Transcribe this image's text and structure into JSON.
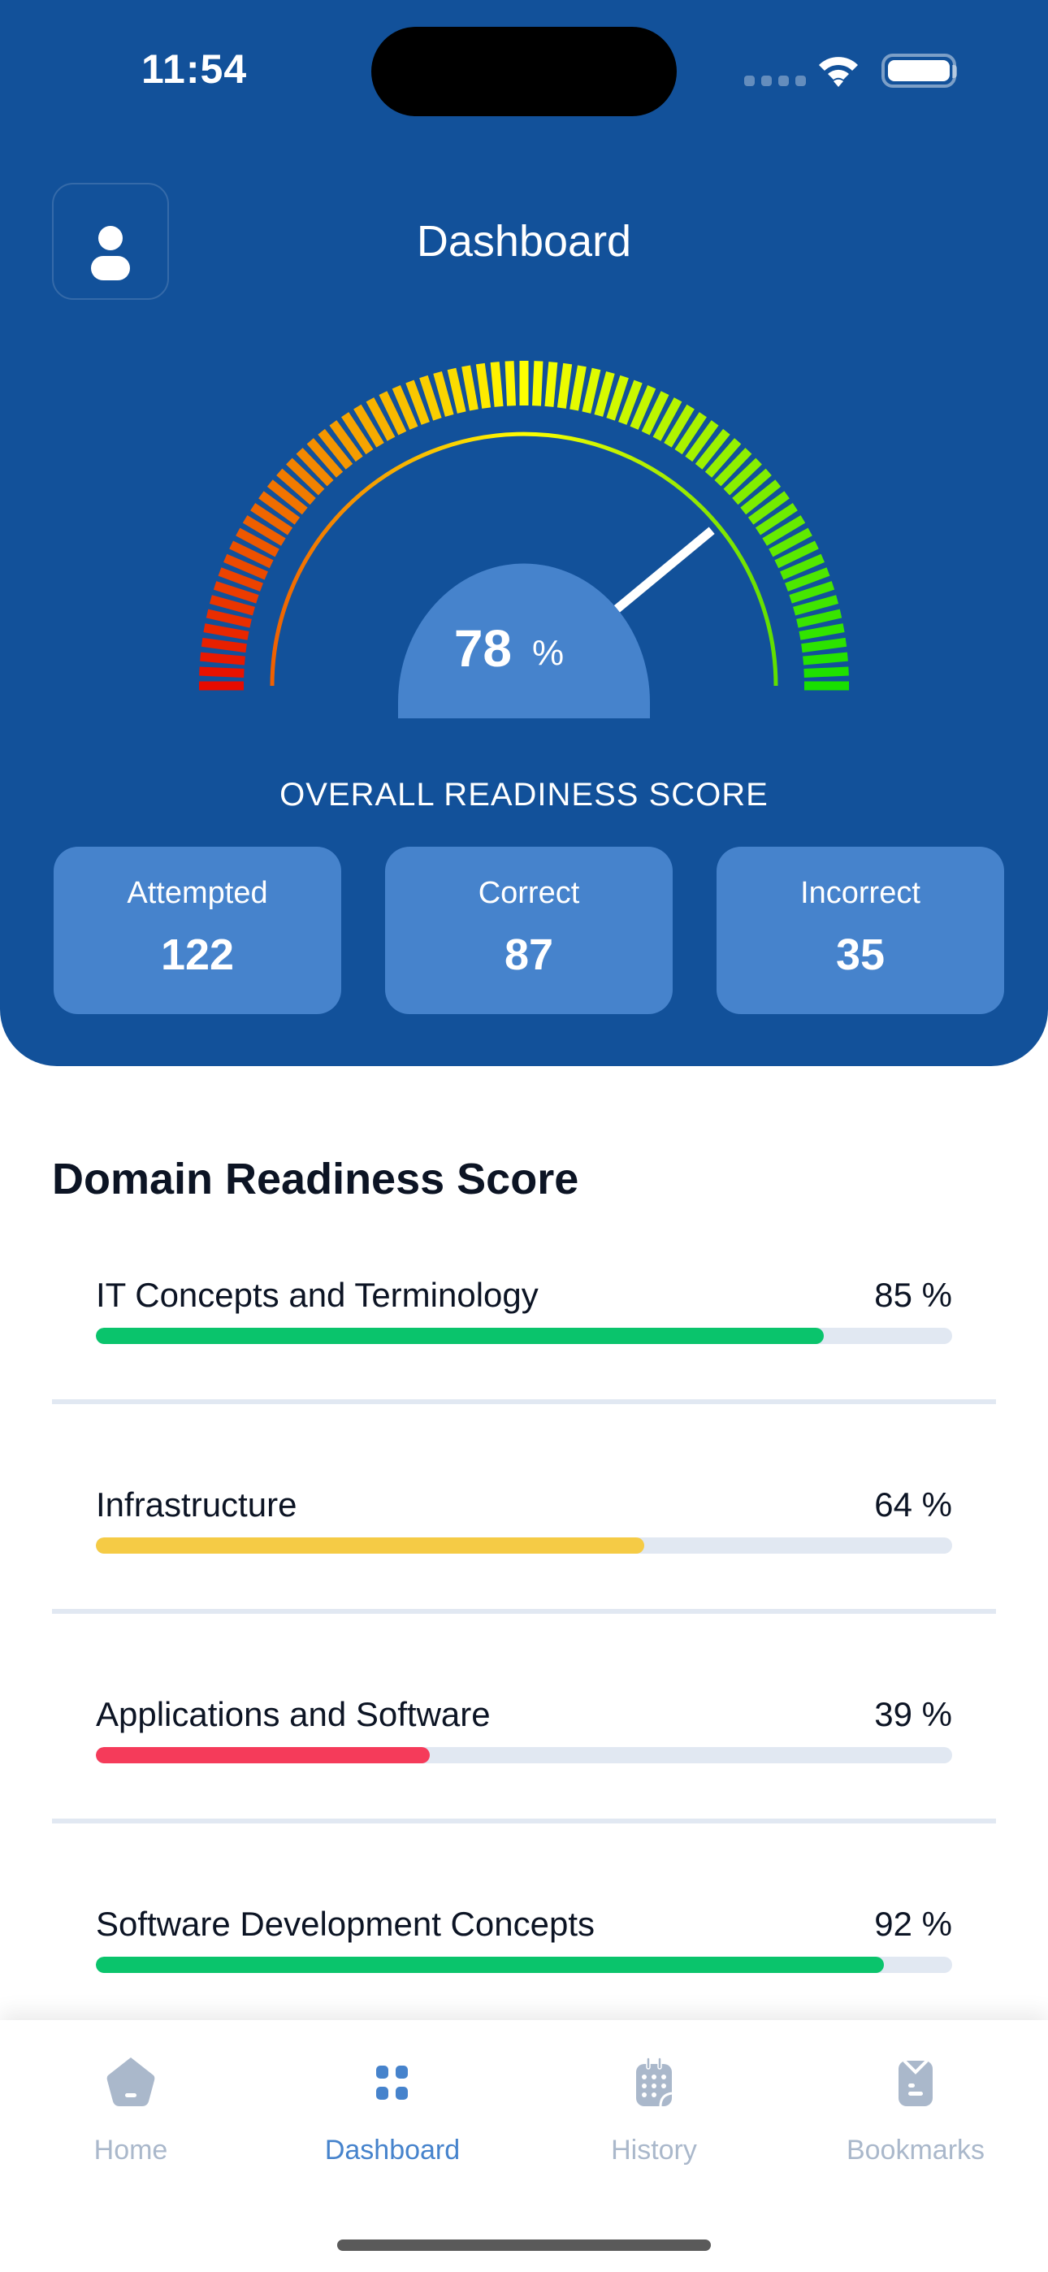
{
  "status_bar": {
    "time": "11:54"
  },
  "header": {
    "title": "Dashboard",
    "profile_icon": "user-icon"
  },
  "gauge": {
    "score_value": "78",
    "score_unit": "%",
    "score_fraction": 0.78,
    "label": "OVERALL READINESS SCORE",
    "colors": {
      "low": "#e60b00",
      "mid": "#ffff00",
      "high": "#18e000",
      "needle": "#ffffff",
      "hub": "#4683cc"
    }
  },
  "stats": [
    {
      "label": "Attempted",
      "value": "122"
    },
    {
      "label": "Correct",
      "value": "87"
    },
    {
      "label": "Incorrect",
      "value": "35"
    }
  ],
  "domain_section": {
    "title": "Domain Readiness Score",
    "items": [
      {
        "name": "IT Concepts and Terminology",
        "percent_text": "85 %",
        "percent": 85,
        "color": "#0ac46c"
      },
      {
        "name": "Infrastructure",
        "percent_text": "64 %",
        "percent": 64,
        "color": "#f5cb45"
      },
      {
        "name": "Applications and Software",
        "percent_text": "39 %",
        "percent": 39,
        "color": "#f53b5a"
      },
      {
        "name": "Software Development Concepts",
        "percent_text": "92 %",
        "percent": 92,
        "color": "#0ac46c"
      }
    ]
  },
  "tabbar": {
    "active_color": "#4683cc",
    "inactive_color": "#aab8cb",
    "tabs": [
      {
        "label": "Home",
        "icon": "home-icon",
        "active": false
      },
      {
        "label": "Dashboard",
        "icon": "dashboard-grid-icon",
        "active": true
      },
      {
        "label": "History",
        "icon": "calendar-icon",
        "active": false
      },
      {
        "label": "Bookmarks",
        "icon": "bookmark-icon",
        "active": false
      }
    ]
  }
}
